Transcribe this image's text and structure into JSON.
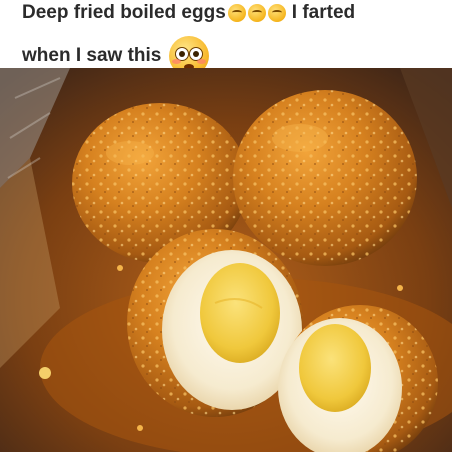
{
  "caption": {
    "line1_text": "Deep fried boiled eggs",
    "line1_suffix": "I farted",
    "line2_text": "when I saw this",
    "emojis": [
      "grimacing-face",
      "grimacing-face",
      "grimacing-face",
      "flushed-face"
    ]
  },
  "photo": {
    "subject": "deep-fried-boiled-eggs",
    "colors": {
      "coating": "#c9791a",
      "yolk": "#f2cf45",
      "white": "#fbf1d6",
      "tray": "#b8b0a6"
    }
  }
}
